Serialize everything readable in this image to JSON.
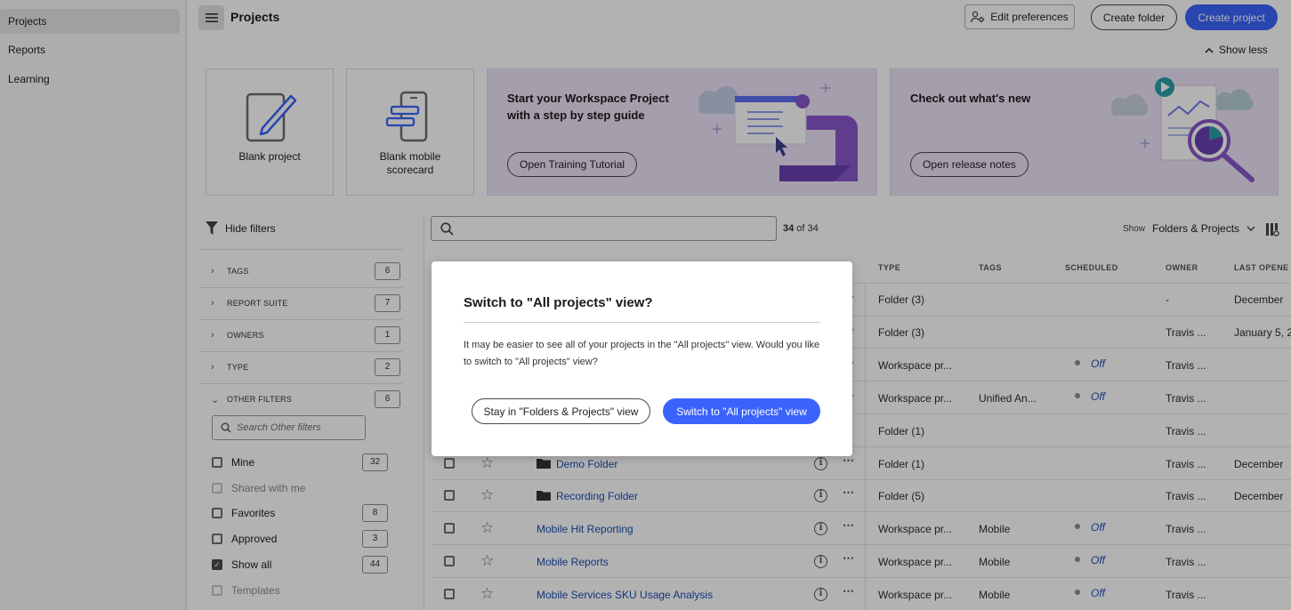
{
  "nav": {
    "items": [
      "Projects",
      "Reports",
      "Learning"
    ],
    "active_index": 0
  },
  "header": {
    "title": "Projects",
    "edit_prefs": "Edit preferences",
    "create_folder": "Create folder",
    "create_project": "Create project",
    "show_less": "Show less"
  },
  "cards": {
    "blank_project": "Blank project",
    "blank_mobile_line1": "Blank mobile",
    "blank_mobile_line2": "scorecard"
  },
  "promos": {
    "training_title": "Start your Workspace Project with a step by step guide",
    "training_btn": "Open Training Tutorial",
    "whatsnew_title": "Check out what's new",
    "whatsnew_btn": "Open release notes"
  },
  "filters": {
    "hide_label": "Hide filters",
    "groups": [
      {
        "label": "TAGS",
        "count": "6"
      },
      {
        "label": "REPORT SUITE",
        "count": "7"
      },
      {
        "label": "OWNERS",
        "count": "1"
      },
      {
        "label": "TYPE",
        "count": "2"
      },
      {
        "label": "OTHER FILTERS",
        "count": "6"
      }
    ],
    "search_placeholder": "Search Other filters",
    "checks": [
      {
        "label": "Mine",
        "count": "32"
      },
      {
        "label": "Shared with me",
        "count": ""
      },
      {
        "label": "Favorites",
        "count": "8"
      },
      {
        "label": "Approved",
        "count": "3"
      },
      {
        "label": "Show all",
        "count": "44"
      },
      {
        "label": "Templates",
        "count": ""
      }
    ]
  },
  "table": {
    "count_num": "34",
    "count_rest": " of 34",
    "show_label": "Show",
    "show_value": "Folders & Projects",
    "headers": {
      "type": "TYPE",
      "tags": "TAGS",
      "scheduled": "SCHEDULED",
      "owner": "OWNER",
      "last_opened": "LAST OPENE"
    },
    "rows": [
      {
        "name": "",
        "type": "Folder (3)",
        "tags": "",
        "scheduled": "",
        "owner": "-",
        "last": "December"
      },
      {
        "name": "",
        "type": "Folder (3)",
        "tags": "",
        "scheduled": "",
        "owner": "Travis ...",
        "last": "January 5, 2"
      },
      {
        "name": "",
        "type": "Workspace pr...",
        "tags": "",
        "scheduled": "Off",
        "owner": "Travis ...",
        "last": ""
      },
      {
        "name": "",
        "type": "Workspace pr...",
        "tags": "Unified An...",
        "scheduled": "Off",
        "owner": "Travis ...",
        "last": ""
      },
      {
        "name": "",
        "type": "Folder (1)",
        "tags": "",
        "scheduled": "",
        "owner": "Travis ...",
        "last": ""
      },
      {
        "name": "Demo Folder",
        "type": "Folder (1)",
        "tags": "",
        "scheduled": "",
        "owner": "Travis ...",
        "last": "December"
      },
      {
        "name": "Recording Folder",
        "type": "Folder (5)",
        "tags": "",
        "scheduled": "",
        "owner": "Travis ...",
        "last": "December"
      },
      {
        "name": "Mobile Hit Reporting",
        "type": "Workspace pr...",
        "tags": "Mobile",
        "scheduled": "Off",
        "owner": "Travis ...",
        "last": ""
      },
      {
        "name": "Mobile Reports",
        "type": "Workspace pr...",
        "tags": "Mobile",
        "scheduled": "Off",
        "owner": "Travis ...",
        "last": ""
      },
      {
        "name": "Mobile Services SKU Usage Analysis",
        "type": "Workspace pr...",
        "tags": "Mobile",
        "scheduled": "Off",
        "owner": "Travis ...",
        "last": ""
      }
    ]
  },
  "dialog": {
    "title": "Switch to \"All projects\" view?",
    "body": "It may be easier to see all of your projects in the \"All projects\" view. Would you like to switch to \"All projects\" view?",
    "stay_btn": "Stay in \"Folders & Projects\" view",
    "switch_btn": "Switch to \"All projects\" view"
  },
  "colors": {
    "accent": "#3b63fb",
    "link": "#1b4fb0",
    "promo_bg": "#ede3f6"
  }
}
